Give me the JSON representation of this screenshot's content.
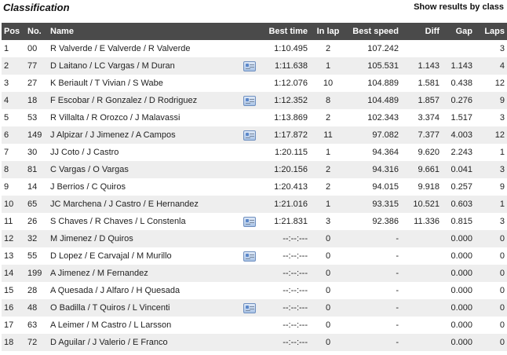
{
  "header": {
    "title": "Classification",
    "toggle_label": "Show results by class"
  },
  "columns": {
    "pos": "Pos",
    "no": "No.",
    "name": "Name",
    "best_time": "Best time",
    "in_lap": "In lap",
    "best_speed": "Best speed",
    "diff": "Diff",
    "gap": "Gap",
    "laps": "Laps"
  },
  "icons": {
    "comment": "comment-icon"
  },
  "rows": [
    {
      "pos": "1",
      "no": "00",
      "name": "R Valverde / E Valverde / R Valverde",
      "icon": false,
      "best_time": "1:10.495",
      "in_lap": "2",
      "best_speed": "107.242",
      "diff": "",
      "gap": "",
      "laps": "3"
    },
    {
      "pos": "2",
      "no": "77",
      "name": "D Laitano / LC Vargas / M Duran",
      "icon": true,
      "best_time": "1:11.638",
      "in_lap": "1",
      "best_speed": "105.531",
      "diff": "1.143",
      "gap": "1.143",
      "laps": "4"
    },
    {
      "pos": "3",
      "no": "27",
      "name": "K Beriault / T Vivian / S Wabe",
      "icon": false,
      "best_time": "1:12.076",
      "in_lap": "10",
      "best_speed": "104.889",
      "diff": "1.581",
      "gap": "0.438",
      "laps": "12"
    },
    {
      "pos": "4",
      "no": "18",
      "name": "F Escobar / R Gonzalez / D Rodriguez",
      "icon": true,
      "best_time": "1:12.352",
      "in_lap": "8",
      "best_speed": "104.489",
      "diff": "1.857",
      "gap": "0.276",
      "laps": "9"
    },
    {
      "pos": "5",
      "no": "53",
      "name": "R Villalta / R Orozco / J Malavassi",
      "icon": false,
      "best_time": "1:13.869",
      "in_lap": "2",
      "best_speed": "102.343",
      "diff": "3.374",
      "gap": "1.517",
      "laps": "3"
    },
    {
      "pos": "6",
      "no": "149",
      "name": "J Alpizar / J Jimenez / A Campos",
      "icon": true,
      "best_time": "1:17.872",
      "in_lap": "11",
      "best_speed": "97.082",
      "diff": "7.377",
      "gap": "4.003",
      "laps": "12"
    },
    {
      "pos": "7",
      "no": "30",
      "name": "JJ Coto / J Castro",
      "icon": false,
      "best_time": "1:20.115",
      "in_lap": "1",
      "best_speed": "94.364",
      "diff": "9.620",
      "gap": "2.243",
      "laps": "1"
    },
    {
      "pos": "8",
      "no": "81",
      "name": "C Vargas / O Vargas",
      "icon": false,
      "best_time": "1:20.156",
      "in_lap": "2",
      "best_speed": "94.316",
      "diff": "9.661",
      "gap": "0.041",
      "laps": "3"
    },
    {
      "pos": "9",
      "no": "14",
      "name": "J Berrios / C Quiros",
      "icon": false,
      "best_time": "1:20.413",
      "in_lap": "2",
      "best_speed": "94.015",
      "diff": "9.918",
      "gap": "0.257",
      "laps": "9"
    },
    {
      "pos": "10",
      "no": "65",
      "name": "JC Marchena / J Castro / E Hernandez",
      "icon": false,
      "best_time": "1:21.016",
      "in_lap": "1",
      "best_speed": "93.315",
      "diff": "10.521",
      "gap": "0.603",
      "laps": "1"
    },
    {
      "pos": "11",
      "no": "26",
      "name": "S Chaves / R Chaves / L Constenla",
      "icon": true,
      "best_time": "1:21.831",
      "in_lap": "3",
      "best_speed": "92.386",
      "diff": "11.336",
      "gap": "0.815",
      "laps": "3"
    },
    {
      "pos": "12",
      "no": "32",
      "name": "M Jimenez / D Quiros",
      "icon": false,
      "best_time": "--:--:---",
      "in_lap": "0",
      "best_speed": "-",
      "diff": "",
      "gap": "0.000",
      "laps": "0"
    },
    {
      "pos": "13",
      "no": "55",
      "name": "D Lopez / E Carvajal / M Murillo",
      "icon": true,
      "best_time": "--:--:---",
      "in_lap": "0",
      "best_speed": "-",
      "diff": "",
      "gap": "0.000",
      "laps": "0"
    },
    {
      "pos": "14",
      "no": "199",
      "name": "A Jimenez / M Fernandez",
      "icon": false,
      "best_time": "--:--:---",
      "in_lap": "0",
      "best_speed": "-",
      "diff": "",
      "gap": "0.000",
      "laps": "0"
    },
    {
      "pos": "15",
      "no": "28",
      "name": "A Quesada / J Alfaro / H Quesada",
      "icon": false,
      "best_time": "--:--:---",
      "in_lap": "0",
      "best_speed": "-",
      "diff": "",
      "gap": "0.000",
      "laps": "0"
    },
    {
      "pos": "16",
      "no": "48",
      "name": "O Badilla / T Quiros / L Vincenti",
      "icon": true,
      "best_time": "--:--:---",
      "in_lap": "0",
      "best_speed": "-",
      "diff": "",
      "gap": "0.000",
      "laps": "0"
    },
    {
      "pos": "17",
      "no": "63",
      "name": "A Leimer / M Castro / L Larsson",
      "icon": false,
      "best_time": "--:--:---",
      "in_lap": "0",
      "best_speed": "-",
      "diff": "",
      "gap": "0.000",
      "laps": "0"
    },
    {
      "pos": "18",
      "no": "72",
      "name": "D Aguilar / J Valerio / E Franco",
      "icon": false,
      "best_time": "--:--:---",
      "in_lap": "0",
      "best_speed": "-",
      "diff": "",
      "gap": "0.000",
      "laps": "0"
    }
  ]
}
